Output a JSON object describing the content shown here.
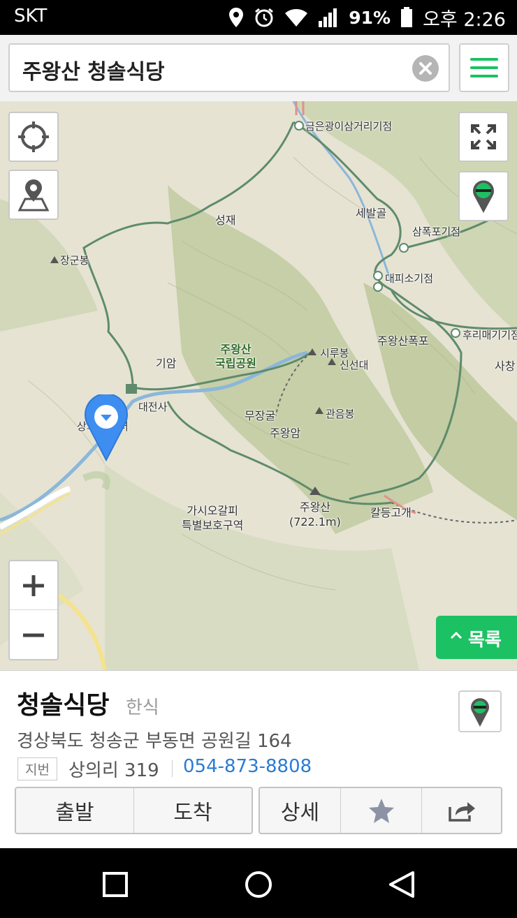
{
  "status_bar": {
    "carrier": "SKT",
    "battery": "91%",
    "time": "오후 2:26",
    "icons": [
      "location-icon",
      "alarm-icon",
      "wifi-icon",
      "signal-icon",
      "battery-icon"
    ]
  },
  "search": {
    "query": "주왕산 청솔식당",
    "clear_icon": "clear-icon",
    "menu_icon": "hamburger-menu-icon"
  },
  "map": {
    "labels": {
      "geumeun": "금은광이삼거리기점",
      "seongjae": "성재",
      "sebalgol": "세발골",
      "sampokpo": "삼폭포기점",
      "janggunbong": "장군봉",
      "daepiso": "대피소기점",
      "hurimaegi": "후리매기기점",
      "juwangsan_falls": "주왕산폭포",
      "saechang": "사창",
      "giam": "기암",
      "park_line1": "주왕산",
      "park_line2": "국립공원",
      "sirubong": "시루봉",
      "sinseondae": "신선대",
      "temple": "대전사",
      "center": "상의   원센터",
      "mujanggul": "무장굴",
      "gwaneumbong": "관음봉",
      "juwangam": "주왕암",
      "gasio_1": "가시오갈피",
      "gasio_2": "특별보호구역",
      "summit_name": "주왕산",
      "summit_height": "(722.1m)",
      "kaldeung": "칼등고개",
      "list_button": "목록"
    },
    "colors": {
      "land": "#e6e3d3",
      "forest": "#c9d2ad",
      "trail": "#5a8a6a",
      "road": "#ffffff",
      "river": "#7fb1d8",
      "pin": "#3d8ef0",
      "accent": "#1cc163"
    }
  },
  "place": {
    "name": "청솔식당",
    "category": "한식",
    "address": "경상북도 청송군 부동면 공원길 164",
    "jibun_tag": "지번",
    "jibun": "상의리 319",
    "phone": "054-873-8808",
    "buttons": {
      "depart": "출발",
      "arrive": "도착",
      "detail": "상세",
      "favorite_icon": "star-icon",
      "share_icon": "share-icon"
    }
  },
  "nav_bar": {
    "icons": [
      "recent-apps-icon",
      "home-icon",
      "back-icon"
    ]
  }
}
